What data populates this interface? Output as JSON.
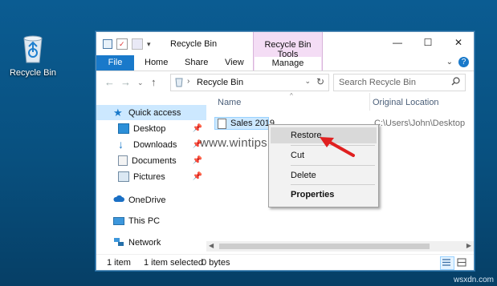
{
  "desktop": {
    "recycle_bin_label": "Recycle Bin",
    "watermark": "wsxdn.com"
  },
  "window": {
    "title": "Recycle Bin",
    "contextual_tab_group": "Recycle Bin Tools",
    "contextual_tab": "Manage",
    "ribbon_tabs": [
      "File",
      "Home",
      "Share",
      "View"
    ],
    "controls": {
      "minimize": "—",
      "maximize": "☐",
      "close": "✕"
    }
  },
  "address_bar": {
    "path": "Recycle Bin",
    "search_placeholder": "Search Recycle Bin"
  },
  "nav": {
    "items": [
      {
        "label": "Quick access",
        "icon": "star-icon",
        "pinned": false
      },
      {
        "label": "Desktop",
        "icon": "desktop-folder-icon",
        "pinned": true
      },
      {
        "label": "Downloads",
        "icon": "download-icon",
        "pinned": true
      },
      {
        "label": "Documents",
        "icon": "documents-icon",
        "pinned": true
      },
      {
        "label": "Pictures",
        "icon": "pictures-icon",
        "pinned": true
      },
      {
        "label": "OneDrive",
        "icon": "cloud-icon",
        "pinned": false
      },
      {
        "label": "This PC",
        "icon": "computer-icon",
        "pinned": false
      },
      {
        "label": "Network",
        "icon": "network-icon",
        "pinned": false
      }
    ]
  },
  "columns": {
    "name": "Name",
    "original_location": "Original Location"
  },
  "files": [
    {
      "name": "Sales 2019",
      "location": "C:\\Users\\John\\Desktop"
    }
  ],
  "context_menu": {
    "items": [
      "Restore",
      "Cut",
      "Delete",
      "Properties"
    ]
  },
  "status": {
    "count": "1 item",
    "selected": "1 item selected",
    "size": "0 bytes"
  },
  "overlay": {
    "watermark": "www.wintips.org"
  },
  "colors": {
    "accent": "#1979ca",
    "selection": "#cce8ff",
    "tools_tab": "#f4ddf5",
    "arrow": "#e02020"
  }
}
